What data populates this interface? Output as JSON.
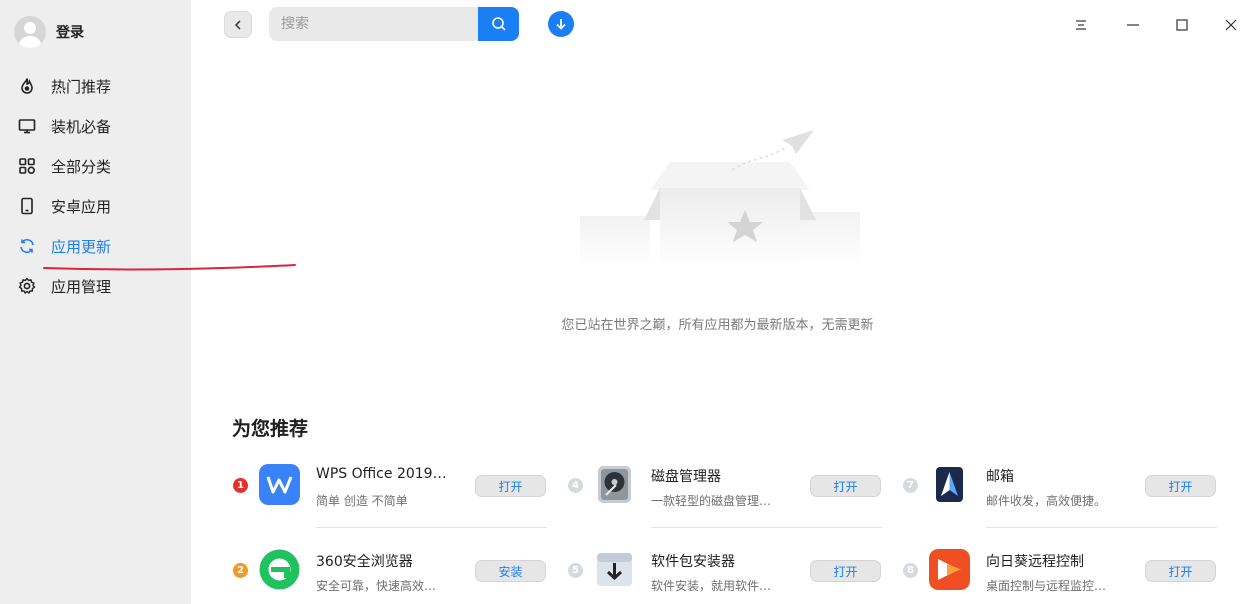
{
  "sidebar": {
    "user_label": "登录",
    "items": [
      {
        "label": "热门推荐",
        "icon": "flame-icon"
      },
      {
        "label": "装机必备",
        "icon": "monitor-icon"
      },
      {
        "label": "全部分类",
        "icon": "grid-icon"
      },
      {
        "label": "安卓应用",
        "icon": "phone-icon"
      },
      {
        "label": "应用更新",
        "icon": "refresh-icon",
        "active": true
      },
      {
        "label": "应用管理",
        "icon": "gear-icon"
      }
    ]
  },
  "search": {
    "placeholder": "搜索"
  },
  "empty_state": {
    "message": "您已站在世界之巅，所有应用都为最新版本，无需更新"
  },
  "recommend": {
    "title": "为您推荐",
    "items": [
      {
        "rank": "1",
        "name": "WPS Office 2019 F…",
        "desc": "简单 创造 不简单",
        "button": "打开",
        "icon": "wps-icon"
      },
      {
        "rank": "2",
        "name": "360安全浏览器",
        "desc": "安全可靠，快速高效…",
        "button": "安装",
        "icon": "browser-360-icon"
      },
      {
        "rank": "4",
        "name": "磁盘管理器",
        "desc": "一款轻型的磁盘管理…",
        "button": "打开",
        "icon": "disk-icon"
      },
      {
        "rank": "5",
        "name": "软件包安装器",
        "desc": "软件安装，就用软件…",
        "button": "打开",
        "icon": "package-icon"
      },
      {
        "rank": "7",
        "name": "邮箱",
        "desc": "邮件收发，高效便捷。",
        "button": "打开",
        "icon": "mail-icon"
      },
      {
        "rank": "8",
        "name": "向日葵远程控制",
        "desc": "桌面控制与远程监控…",
        "button": "打开",
        "icon": "sunlogin-icon"
      }
    ]
  },
  "colors": {
    "accent": "#1a7ef5",
    "sidebar_bg": "#eeeeee",
    "rank1": "#e8312a",
    "rank2": "#f39a26"
  }
}
